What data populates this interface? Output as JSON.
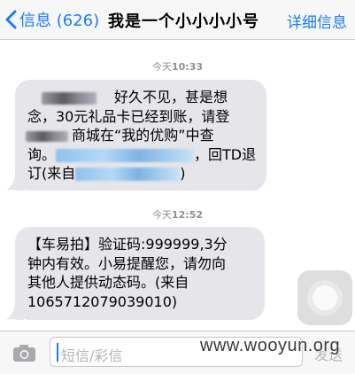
{
  "nav": {
    "back_label": "信息 (626)",
    "title": "我是一个小小小小号",
    "detail_label": "详细信息"
  },
  "messages": [
    {
      "timestamp_day": "今天",
      "timestamp_time": "10:33",
      "lines": {
        "l1_text": "好久不见，甚是想",
        "l2_text": "念，30元礼品卡已经到账，请登",
        "l3_text": "商城在“我的优购”中查",
        "l4_end": "，回TD退",
        "l5_start": "订(来自",
        "l5_end": ")"
      }
    },
    {
      "timestamp_day": "今天",
      "timestamp_time": "12:52",
      "lines": {
        "l1": "【车易拍】验证码:999999,3分",
        "l2": "钟内有效。小易提醒您，请勿向",
        "l3": "其他人提供动态码。(来自",
        "l4": "1065712079039010)"
      }
    }
  ],
  "composer": {
    "placeholder": "短信/彩信",
    "send_label": "发送"
  },
  "watermark": "www.wooyun.org",
  "colors": {
    "accent": "#1a7cf6",
    "bubble_incoming": "#e5e5ea",
    "timestamp": "#8e8e93"
  }
}
